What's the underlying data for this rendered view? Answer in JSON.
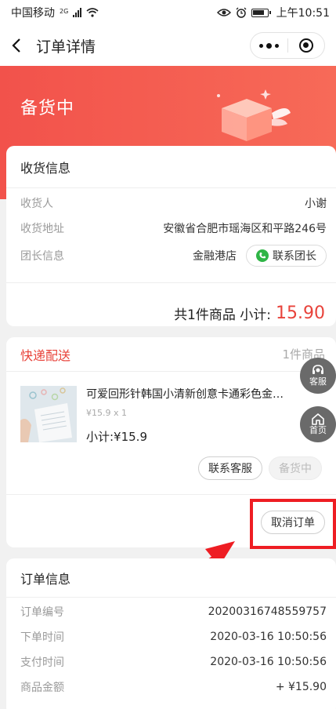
{
  "status_bar": {
    "carrier": "中国移动",
    "network": "2G",
    "time": "上午10:51"
  },
  "nav": {
    "title": "订单详情",
    "back_icon": "chevron-left-icon",
    "more_icon": "more-dots-icon",
    "close_icon": "target-circle-icon"
  },
  "hero": {
    "status_text": "备货中",
    "color_start": "#f2524b",
    "color_end": "#f76a58"
  },
  "receiving": {
    "title": "收货信息",
    "receiver_label": "收货人",
    "receiver_value": "小谢",
    "address_label": "收货地址",
    "address_value": "安徽省合肥市瑶海区和平路246号",
    "leader_label": "团长信息",
    "leader_value": "金融港店",
    "contact_leader_label": "联系团长",
    "subtotal_text": "共1件商品 小计:",
    "subtotal_amount": "15.90"
  },
  "delivery": {
    "method": "快递配送",
    "item_count": "1件商品",
    "product": {
      "name": "可爱回形针韩国小清新创意卡通彩色金属曲别针",
      "spec": "¥15.9 x 1",
      "subtotal": "小计:¥15.9"
    },
    "contact_service_label": "联系客服",
    "status_pill_label": "备货中",
    "cancel_label": "取消订单"
  },
  "order_info": {
    "title": "订单信息",
    "rows": [
      {
        "label": "订单编号",
        "value": "20200316748559757"
      },
      {
        "label": "下单时间",
        "value": "2020-03-16 10:50:56"
      },
      {
        "label": "支付时间",
        "value": "2020-03-16 10:50:56"
      },
      {
        "label": "商品金额",
        "value": "+ ¥15.90"
      }
    ]
  },
  "floating": {
    "service_label": "客服",
    "home_label": "首页"
  },
  "colors": {
    "accent": "#e8433b",
    "annotation": "#ee1d23",
    "phone_green": "#2fb546"
  }
}
